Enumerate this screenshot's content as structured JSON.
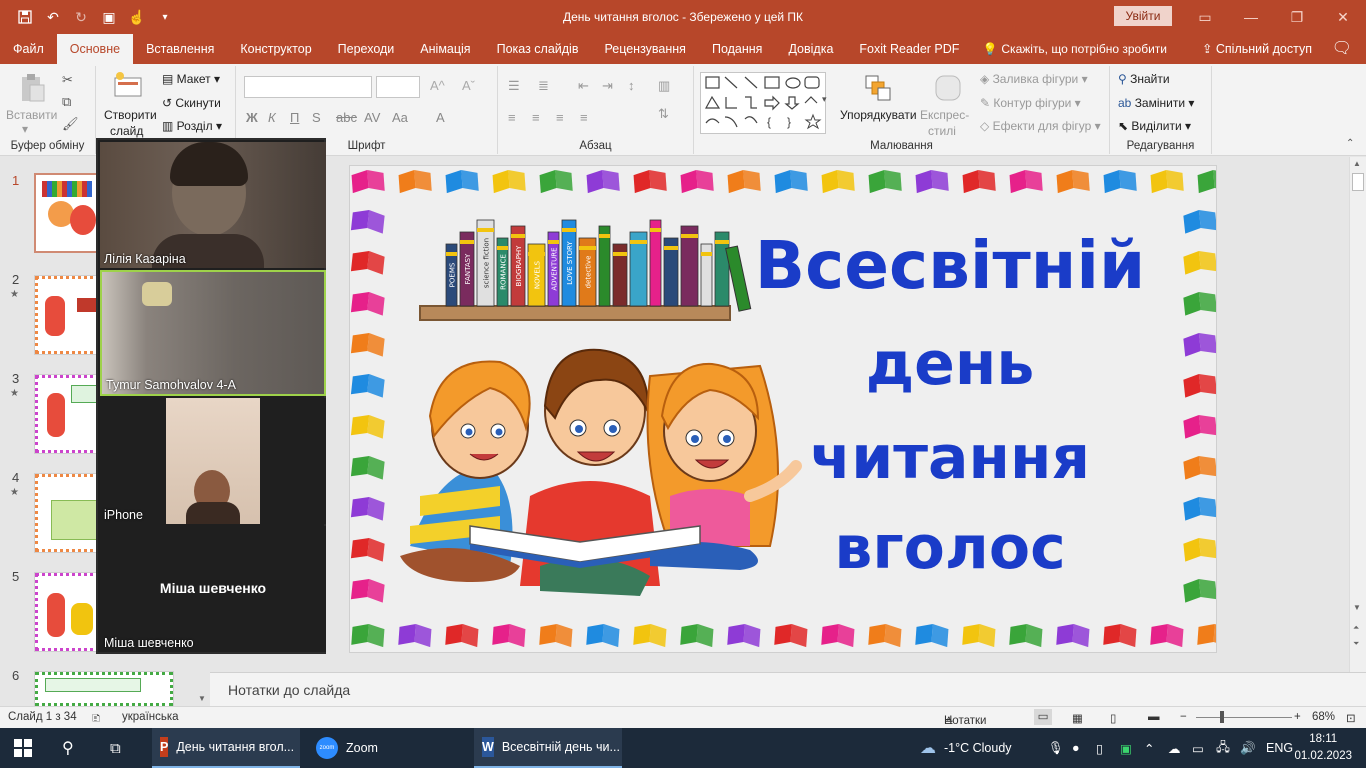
{
  "window": {
    "title": "День читання вголос  -  Збережено у цей ПК",
    "signin_label": "Увійти"
  },
  "tabs": [
    {
      "label": "Файл"
    },
    {
      "label": "Основне"
    },
    {
      "label": "Вставлення"
    },
    {
      "label": "Конструктор"
    },
    {
      "label": "Переходи"
    },
    {
      "label": "Анімація"
    },
    {
      "label": "Показ слайдів"
    },
    {
      "label": "Рецензування"
    },
    {
      "label": "Подання"
    },
    {
      "label": "Довідка"
    },
    {
      "label": "Foxit Reader PDF"
    }
  ],
  "tell_me": "Скажіть, що потрібно зробити",
  "share_label": "Спільний доступ",
  "ribbon": {
    "clipboard": {
      "paste": "Вставити",
      "group": "Буфер обміну"
    },
    "slides": {
      "new_slide_line1": "Створити",
      "new_slide_line2": "слайд",
      "layout": "Макет",
      "reset": "Скинути",
      "section": "Розділ"
    },
    "font": {
      "group": "Шрифт",
      "bold": "Ж",
      "italic": "К",
      "underline": "П",
      "strike": "S",
      "size": "Aa",
      "color": "A"
    },
    "paragraph": {
      "group": "Абзац"
    },
    "drawing": {
      "group": "Малювання",
      "arrange": "Упорядкувати",
      "quick_styles_1": "Експрес-",
      "quick_styles_2": "стилі",
      "fill": "Заливка фігури",
      "outline": "Контур фігури",
      "effects": "Ефекти для фігур"
    },
    "editing": {
      "group": "Редагування",
      "find": "Знайти",
      "replace": "Замінити",
      "select": "Виділити"
    }
  },
  "slide_thumbnails": [
    {
      "num": "1",
      "star": ""
    },
    {
      "num": "2",
      "star": "★"
    },
    {
      "num": "3",
      "star": "★"
    },
    {
      "num": "4",
      "star": "★"
    },
    {
      "num": "5",
      "star": ""
    },
    {
      "num": "6",
      "star": ""
    }
  ],
  "zoom_tiles": [
    {
      "name": "Лілія Казаріна"
    },
    {
      "name": "Tymur Samohvalov 4-А"
    },
    {
      "name": "iPhone"
    },
    {
      "name": "Міша шевченко",
      "center_label": "Міша шевченко"
    }
  ],
  "slide": {
    "title_lines": [
      "Всесвітній",
      "день",
      "читання",
      "вголос"
    ],
    "title_color": "#1a3cc8",
    "book_spines": [
      "POEMS",
      "FANTASY",
      "science fiction",
      "ROMANCE",
      "BIOGRAPHY",
      "NOVELS",
      "ADVENTURE",
      "LOVE STORY",
      "detective"
    ]
  },
  "notes_label": "Нотатки до слайда",
  "status": {
    "slide_counter": "Слайд 1 з 34",
    "language": "українська",
    "notes_button": "Нотатки",
    "zoom": "68%"
  },
  "taskbar": {
    "apps": [
      {
        "label": "День читання вгол..."
      },
      {
        "label": "Zoom"
      },
      {
        "label": "Всесвітній день чи..."
      }
    ],
    "weather": "-1°C  Cloudy",
    "lang": "ENG",
    "time": "18:11",
    "date": "01.02.2023"
  },
  "colors": {
    "accent": "#b7472a",
    "taskbar": "#1c2a3a"
  }
}
